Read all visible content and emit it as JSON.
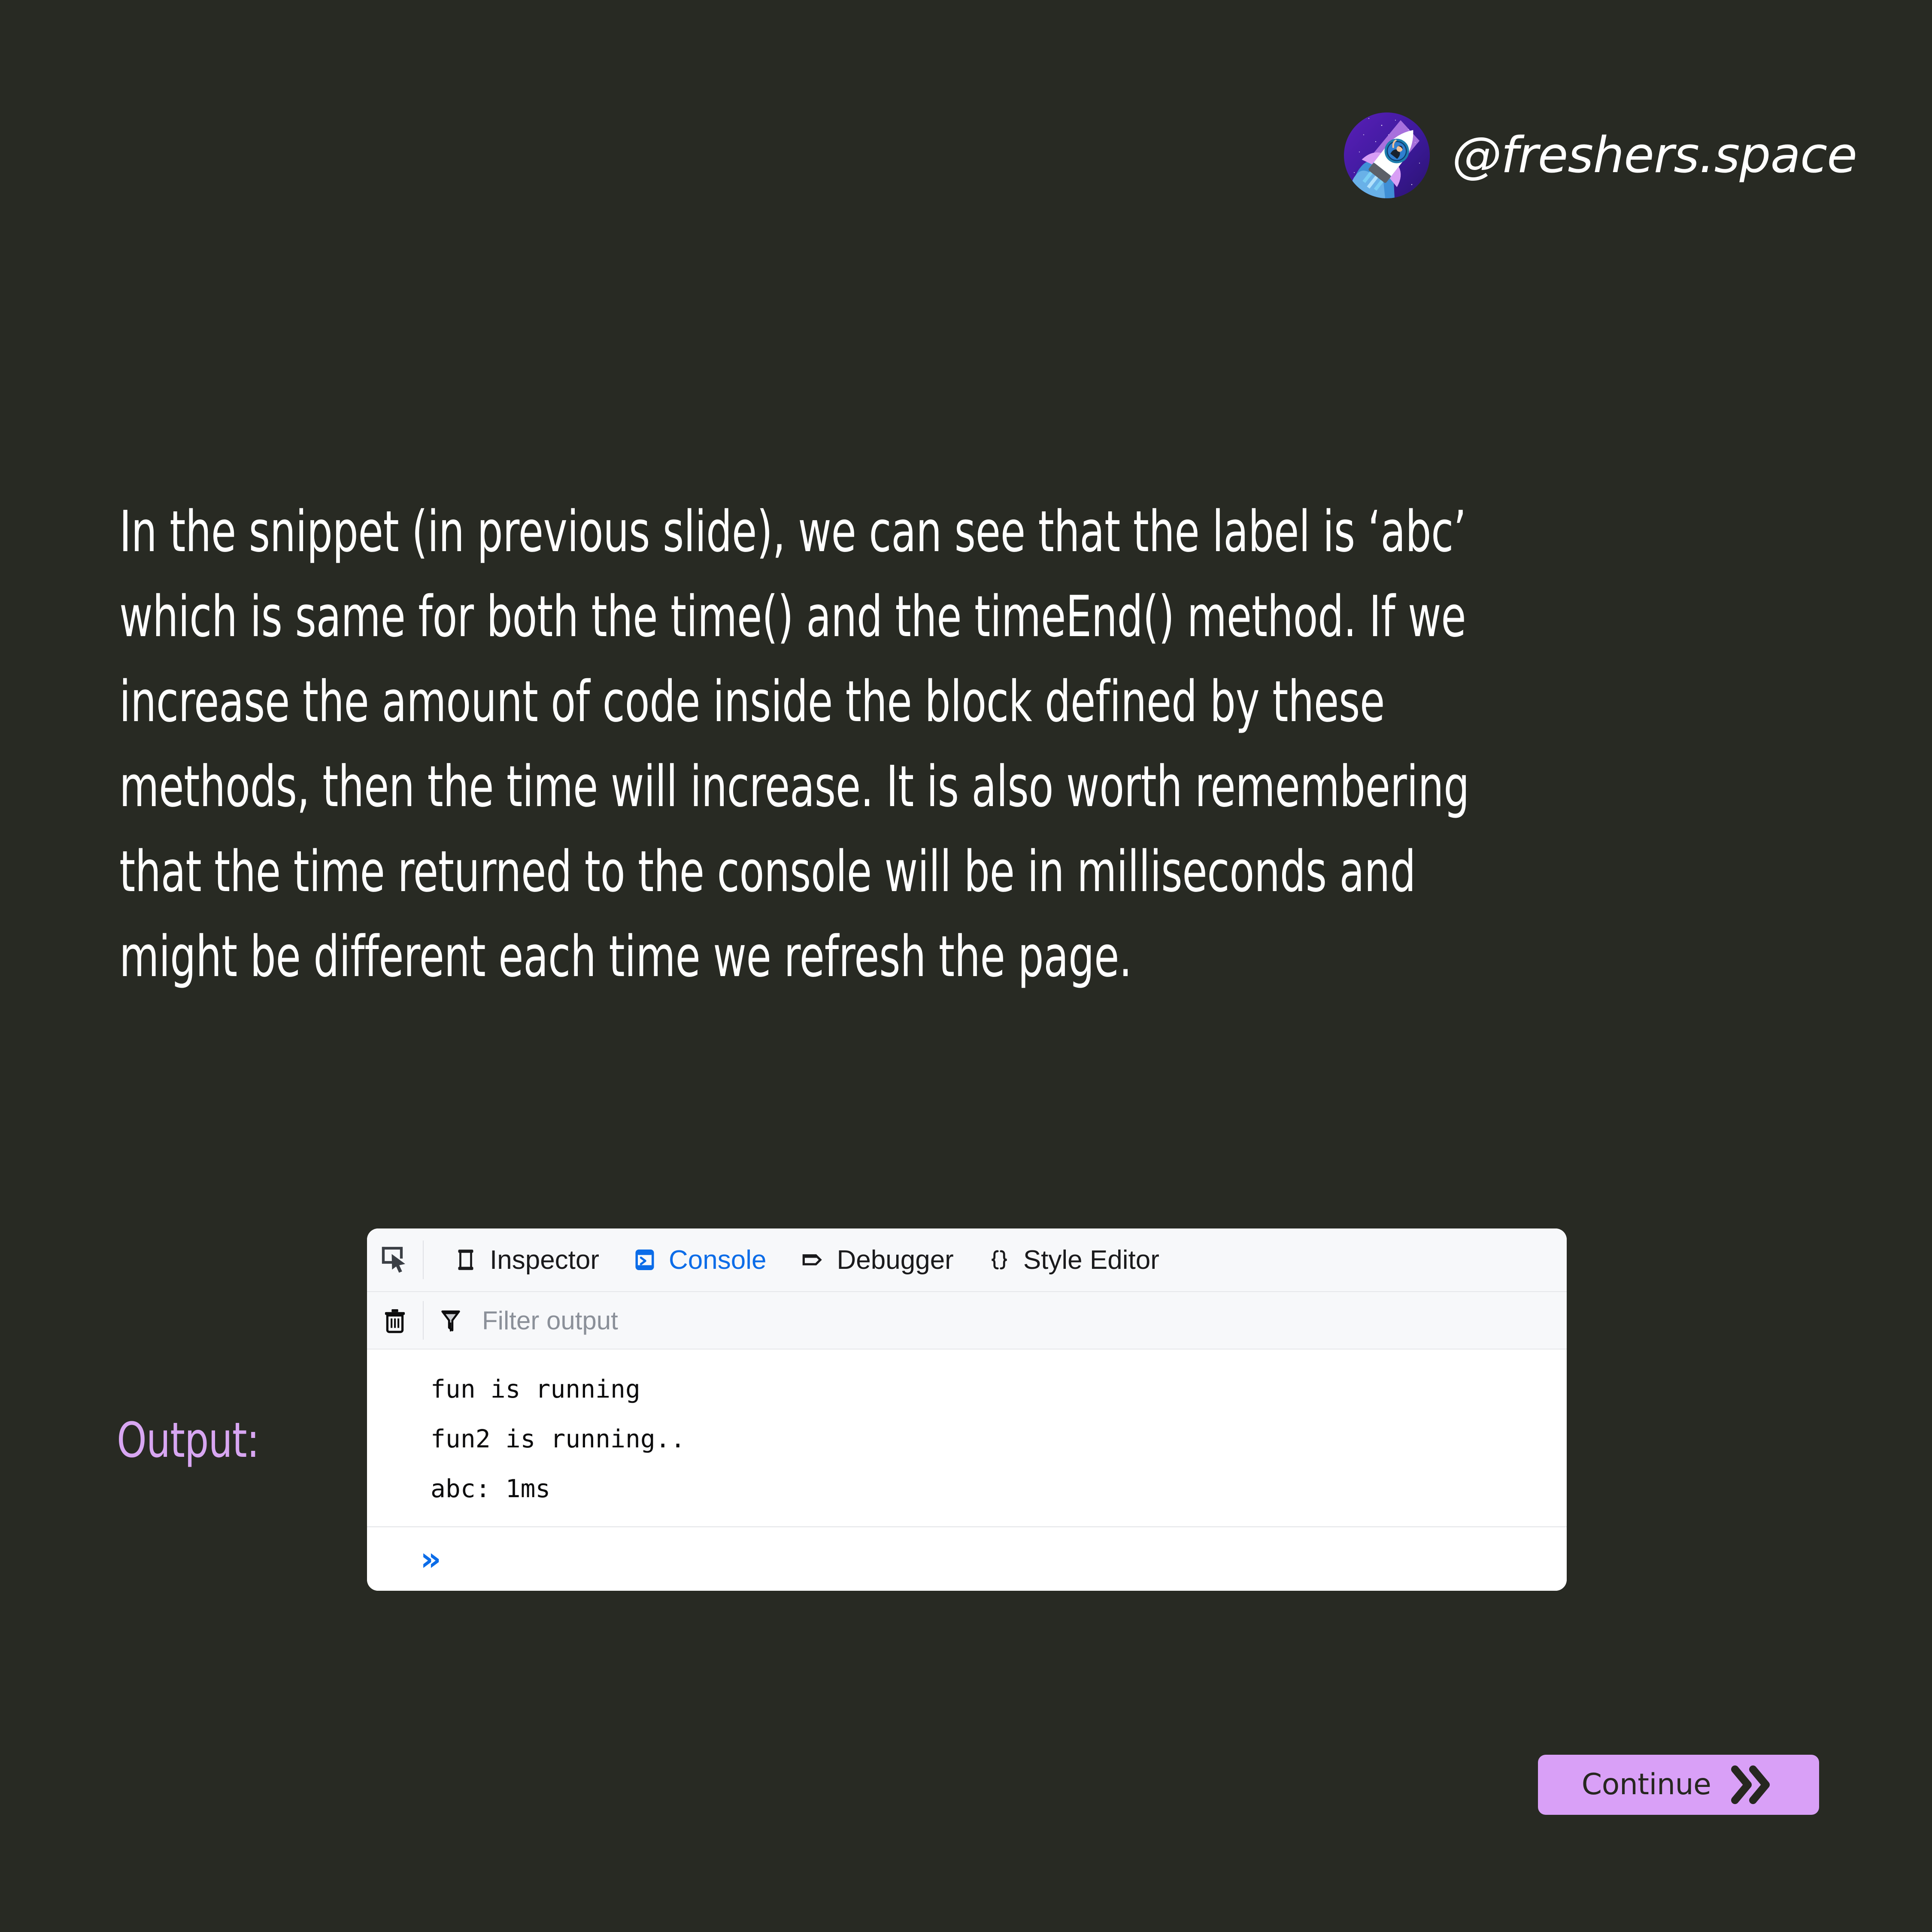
{
  "brand": {
    "handle": "@freshers.space",
    "avatar_alt": "rocket-avatar",
    "avatar_bg": "#4b1fa8"
  },
  "slide": {
    "paragraph": "In the snippet (in previous slide), we can see that the label is ‘abc’ which is same for both the time() and the timeEnd() method. If we increase the amount of code inside the block defined by these methods, then the time will increase. It is also worth remembering that the time returned to the console will be in milliseconds and might be different each time we refresh the page.",
    "output_label": "Output:",
    "text_color": "#ffffff",
    "background_color": "#282a23",
    "accent_color": "#d8a6f2"
  },
  "devtools": {
    "picker_icon": "element-picker-icon",
    "tabs": [
      {
        "label": "Inspector",
        "icon": "inspector-icon",
        "active": false
      },
      {
        "label": "Console",
        "icon": "console-icon",
        "active": true
      },
      {
        "label": "Debugger",
        "icon": "debugger-icon",
        "active": false
      },
      {
        "label": "Style Editor",
        "icon": "style-editor-icon",
        "active": false
      }
    ],
    "active_tab_color": "#0b6ce8",
    "filter": {
      "trash_icon": "trash-icon",
      "funnel_icon": "filter-funnel-icon",
      "value": "",
      "placeholder": "Filter output"
    },
    "console_lines": [
      "fun is running",
      "fun2 is running..",
      "abc: 1ms"
    ],
    "prompt": "»"
  },
  "footer": {
    "continue_label": "Continue",
    "continue_icon": "double-chevron-right-icon",
    "continue_bg": "#d9a0f7"
  }
}
